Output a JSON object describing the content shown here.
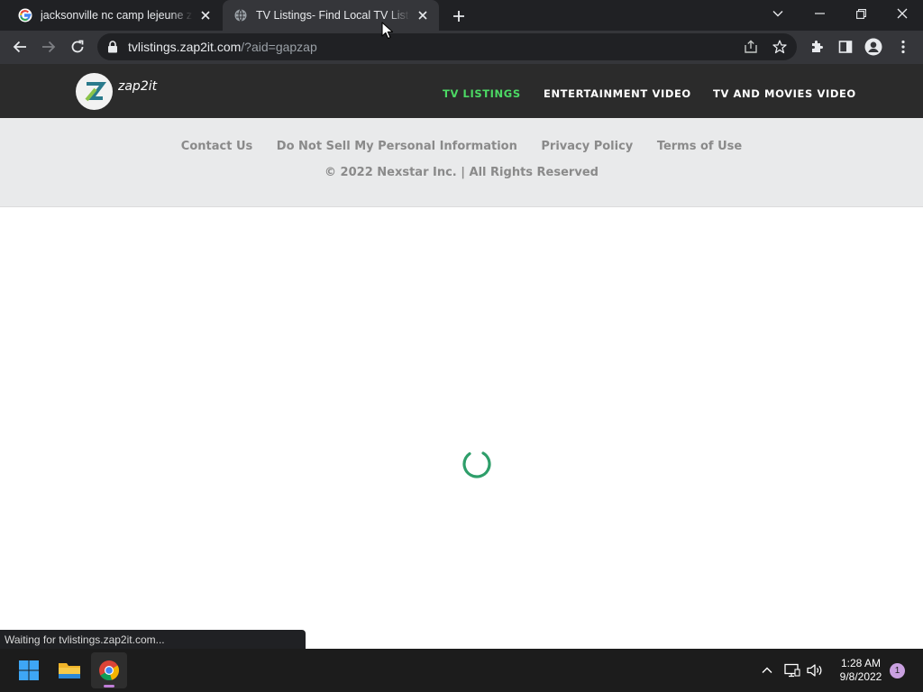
{
  "browser": {
    "tabs": [
      {
        "title": "jacksonville nc camp lejeune zip c",
        "favicon": "google-g-icon",
        "active": false
      },
      {
        "title": "TV Listings- Find Local TV Listings",
        "favicon": "globe-icon",
        "active": true
      }
    ],
    "address": {
      "host": "tvlistings.zap2it.com",
      "path": "/?aid=gapzap"
    }
  },
  "site": {
    "logo_text": "zap2it",
    "nav": [
      {
        "label": "TV LISTINGS",
        "active": true
      },
      {
        "label": "ENTERTAINMENT VIDEO",
        "active": false
      },
      {
        "label": "TV AND MOVIES VIDEO",
        "active": false
      }
    ],
    "footer": {
      "links": [
        "Contact Us",
        "Do Not Sell My Personal Information",
        "Privacy Policy",
        "Terms of Use"
      ],
      "copyright": "© 2022 Nexstar Inc. | All Rights Reserved"
    }
  },
  "status": {
    "text": "Waiting for tvlistings.zap2it.com..."
  },
  "taskbar": {
    "time": "1:28 AM",
    "date": "9/8/2022",
    "notification_count": "1"
  },
  "colors": {
    "accent_green": "#4cd964",
    "spinner_green": "#2e9e6a",
    "header_bg": "#2b2b2b",
    "footer_bg": "#e9eaeb"
  }
}
